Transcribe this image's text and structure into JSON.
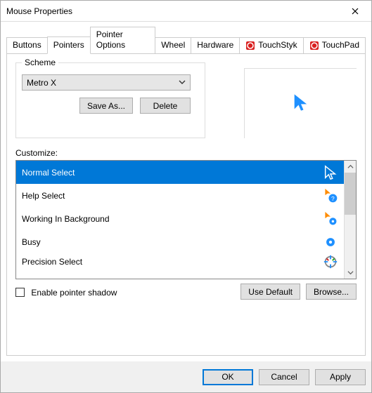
{
  "window": {
    "title": "Mouse Properties"
  },
  "tabs": [
    {
      "label": "Buttons"
    },
    {
      "label": "Pointers"
    },
    {
      "label": "Pointer Options"
    },
    {
      "label": "Wheel"
    },
    {
      "label": "Hardware"
    },
    {
      "label": "TouchStyk"
    },
    {
      "label": "TouchPad"
    }
  ],
  "scheme": {
    "legend": "Scheme",
    "selected": "Metro X",
    "save_as": "Save As...",
    "delete": "Delete"
  },
  "customize": {
    "label": "Customize:",
    "items": [
      {
        "label": "Normal Select",
        "icon": "cursor-arrow"
      },
      {
        "label": "Help Select",
        "icon": "help-circle"
      },
      {
        "label": "Working In Background",
        "icon": "busy-bg"
      },
      {
        "label": "Busy",
        "icon": "busy"
      },
      {
        "label": "Precision Select",
        "icon": "crosshair"
      }
    ],
    "selected_index": 0
  },
  "shadow": {
    "label": "Enable pointer shadow",
    "checked": false
  },
  "use_default": "Use Default",
  "browse": "Browse...",
  "footer": {
    "ok": "OK",
    "cancel": "Cancel",
    "apply": "Apply"
  }
}
